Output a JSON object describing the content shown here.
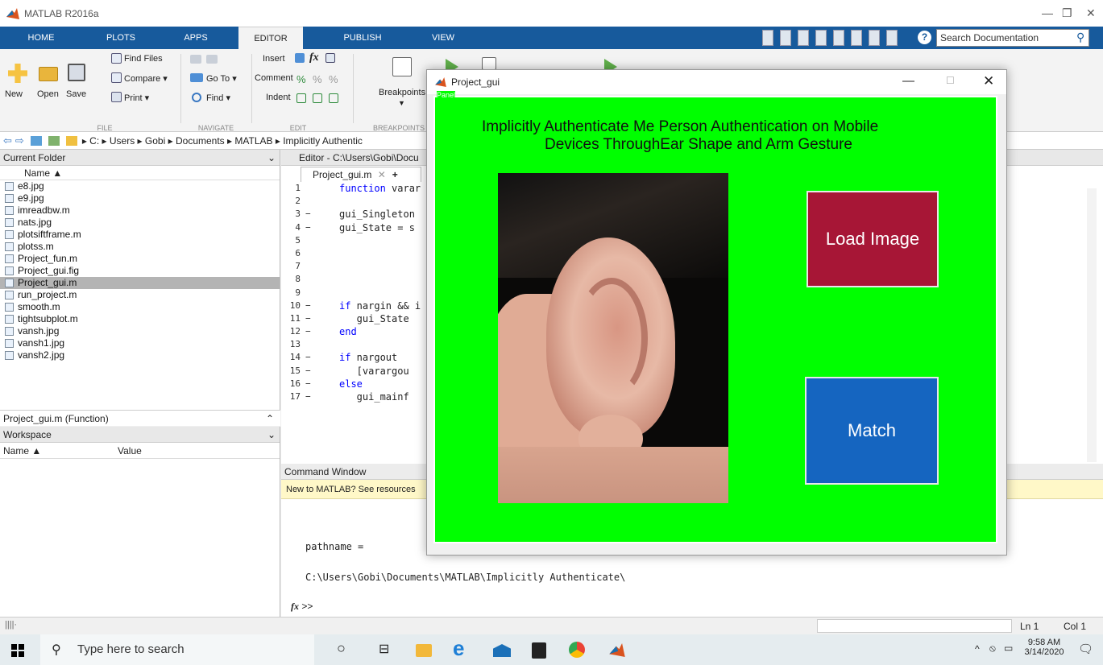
{
  "app": {
    "title": "MATLAB R2016a"
  },
  "ribbon_tabs": [
    "HOME",
    "PLOTS",
    "APPS",
    "EDITOR",
    "PUBLISH",
    "VIEW"
  ],
  "search": {
    "placeholder": "Search Documentation"
  },
  "ribbon": {
    "new": "New",
    "open": "Open",
    "save": "Save",
    "find_files": "Find Files",
    "compare": "Compare",
    "print": "Print",
    "go_to": "Go To",
    "find": "Find",
    "insert": "Insert",
    "comment": "Comment",
    "indent": "Indent",
    "breakpoints": "Breakpoints",
    "groups": {
      "file": "FILE",
      "navigate": "NAVIGATE",
      "edit": "EDIT",
      "breakpoints": "BREAKPOINTS"
    }
  },
  "path": [
    "C:",
    "Users",
    "Gobi",
    "Documents",
    "MATLAB",
    "Implicitly Authentic"
  ],
  "current_folder": {
    "title": "Current Folder",
    "column": "Name",
    "files": [
      "e8.jpg",
      "e9.jpg",
      "imreadbw.m",
      "nats.jpg",
      "plotsiftframe.m",
      "plotss.m",
      "Project_fun.m",
      "Project_gui.fig",
      "Project_gui.m",
      "run_project.m",
      "smooth.m",
      "tightsubplot.m",
      "vansh.jpg",
      "vansh1.jpg",
      "vansh2.jpg"
    ],
    "selected": "Project_gui.m",
    "details": "Project_gui.m (Function)"
  },
  "workspace": {
    "title": "Workspace",
    "col_name": "Name",
    "col_value": "Value"
  },
  "editor": {
    "title": "Editor - C:\\Users\\Gobi\\Docu",
    "tab": "Project_gui.m",
    "lines": [
      {
        "n": "1",
        "m": "",
        "t": "function varar"
      },
      {
        "n": "2",
        "m": "",
        "t": ""
      },
      {
        "n": "3",
        "m": "−",
        "t": "gui_Singleton"
      },
      {
        "n": "4",
        "m": "−",
        "t": "gui_State = s"
      },
      {
        "n": "5",
        "m": "",
        "t": ""
      },
      {
        "n": "6",
        "m": "",
        "t": ""
      },
      {
        "n": "7",
        "m": "",
        "t": ""
      },
      {
        "n": "8",
        "m": "",
        "t": ""
      },
      {
        "n": "9",
        "m": "",
        "t": ""
      },
      {
        "n": "10",
        "m": "−",
        "t": "if nargin && i"
      },
      {
        "n": "11",
        "m": "−",
        "t": "   gui_State"
      },
      {
        "n": "12",
        "m": "−",
        "t": "end"
      },
      {
        "n": "13",
        "m": "",
        "t": ""
      },
      {
        "n": "14",
        "m": "−",
        "t": "if nargout"
      },
      {
        "n": "15",
        "m": "−",
        "t": "   [varargou"
      },
      {
        "n": "16",
        "m": "−",
        "t": "else"
      },
      {
        "n": "17",
        "m": "−",
        "t": "   gui_mainf"
      }
    ]
  },
  "command_window": {
    "title": "Command Window",
    "banner": "New to MATLAB? See resources",
    "lines": [
      "pathname =",
      "C:\\Users\\Gobi\\Documents\\MATLAB\\Implicitly Authenticate\\"
    ],
    "prompt": ">>"
  },
  "status": {
    "ln": "Ln  1",
    "col": "Col  1"
  },
  "taskbar": {
    "search_placeholder": "Type here to search",
    "time": "9:58 AM",
    "date": "3/14/2020"
  },
  "gui": {
    "title": "Project_gui",
    "panel_label": "Panel",
    "heading_line1": "Implicitly Authenticate Me Person Authentication on Mobile",
    "heading_line2": "Devices ThroughEar Shape and Arm Gesture",
    "load_button": "Load Image",
    "match_button": "Match",
    "colors": {
      "panel": "#00ff00",
      "load": "#a71636",
      "match": "#1565c0"
    }
  }
}
